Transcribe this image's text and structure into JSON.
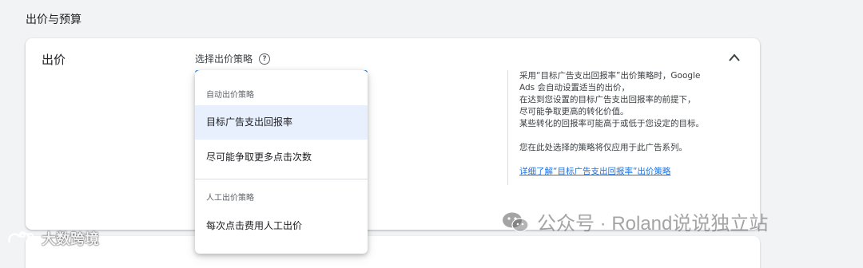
{
  "section": {
    "title": "出价与预算"
  },
  "card": {
    "label": "出价",
    "strategy_label": "选择出价策略",
    "help_icon": "help-circle-icon",
    "collapse_icon": "chevron-up-icon"
  },
  "dropdown": {
    "auto_header": "自动出价策略",
    "items": [
      {
        "label": "目标广告支出回报率",
        "selected": true
      },
      {
        "label": "尽可能争取更多点击次数",
        "selected": false
      }
    ],
    "manual_header": "人工出价策略",
    "manual_items": [
      {
        "label": "每次点击费用人工出价"
      }
    ]
  },
  "info": {
    "lines": [
      "采用“目标广告支出回报率”出价策略时，Google",
      "Ads 会自动设置适当的出价，",
      "在达到您设置的目标广告支出回报率的前提下，",
      "尽可能争取更高的转化价值。",
      "某些转化的回报率可能高于或低于您设定的目标。"
    ],
    "note": "您在此处选择的策略将仅应用于此广告系列。",
    "link": "详细了解“目标广告支出回报率”出价策略"
  },
  "watermarks": {
    "wechat": "公众号 · Roland说说独立站",
    "brand": "大数跨境"
  },
  "colors": {
    "accent": "#1a73e8",
    "selected_bg": "#e8f0fe"
  }
}
